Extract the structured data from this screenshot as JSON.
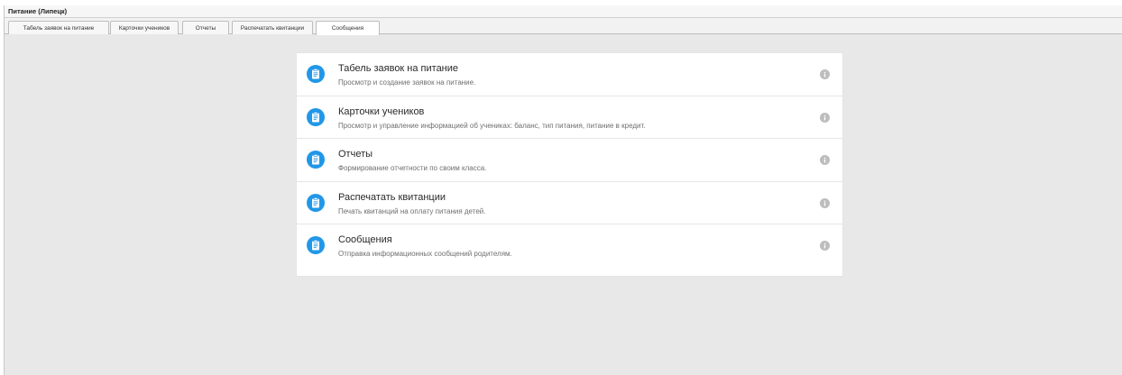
{
  "window": {
    "title": "Питание (Липецк)"
  },
  "tabs": [
    {
      "label": "Табель заявок на питание"
    },
    {
      "label": "Карточки учеников"
    },
    {
      "label": "Отчеты"
    },
    {
      "label": "Распечатать квитанции"
    },
    {
      "label": "Сообщения"
    }
  ],
  "menu": {
    "items": [
      {
        "title": "Табель заявок на питание",
        "description": "Просмотр и создание заявок на питание.",
        "icon": "clipboard-icon"
      },
      {
        "title": "Карточки учеников",
        "description": "Просмотр и управление информацией об учениках: баланс, тип питания, питание в кредит.",
        "icon": "clipboard-icon"
      },
      {
        "title": "Отчеты",
        "description": "Формирование отчетности по своим класса.",
        "icon": "clipboard-icon"
      },
      {
        "title": "Распечатать квитанции",
        "description": "Печать квитанций на оплату питания детей.",
        "icon": "clipboard-icon"
      },
      {
        "title": "Сообщения",
        "description": "Отправка информационных сообщений родителям.",
        "icon": "clipboard-icon"
      }
    ]
  },
  "colors": {
    "accent": "#2197e8",
    "background": "#e8e8e8",
    "info_icon": "#bdbdbd"
  }
}
